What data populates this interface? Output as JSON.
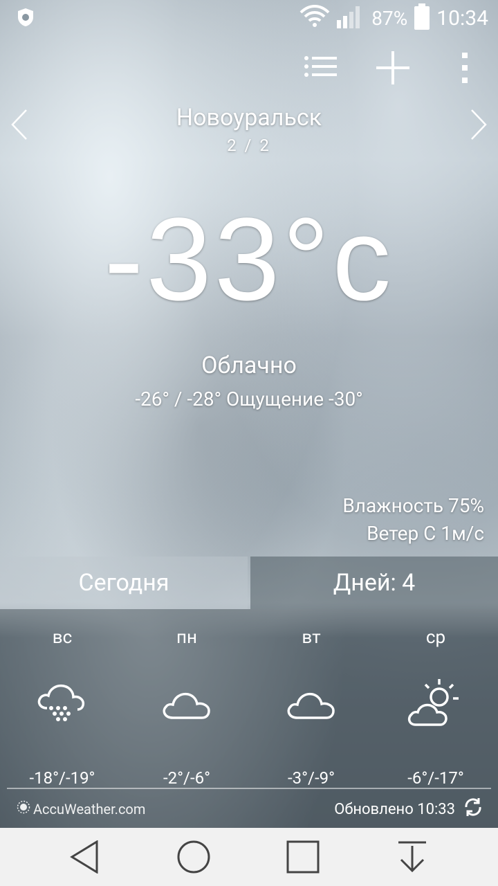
{
  "status": {
    "battery": "87%",
    "time": "10:34"
  },
  "location": {
    "city": "Новоуральск",
    "pager": "2 / 2"
  },
  "current": {
    "temperature": "-33°c",
    "condition": "Облачно",
    "hilo_feel": "-26° / -28° Ощущение -30°",
    "humidity": "Влажность 75%",
    "wind": "Ветер С 1м/с"
  },
  "tabs": {
    "today": "Сегодня",
    "days": "Дней: 4"
  },
  "forecast": [
    {
      "day": "вс",
      "icon": "snow-cloud-icon",
      "range": "-18°/-19°"
    },
    {
      "day": "пн",
      "icon": "cloud-icon",
      "range": "-2°/-6°"
    },
    {
      "day": "вт",
      "icon": "cloud-icon",
      "range": "-3°/-9°"
    },
    {
      "day": "ср",
      "icon": "partly-sunny-icon",
      "range": "-6°/-17°"
    }
  ],
  "footer": {
    "brand": "AccuWeather.com",
    "updated": "Обновлено 10:33"
  }
}
